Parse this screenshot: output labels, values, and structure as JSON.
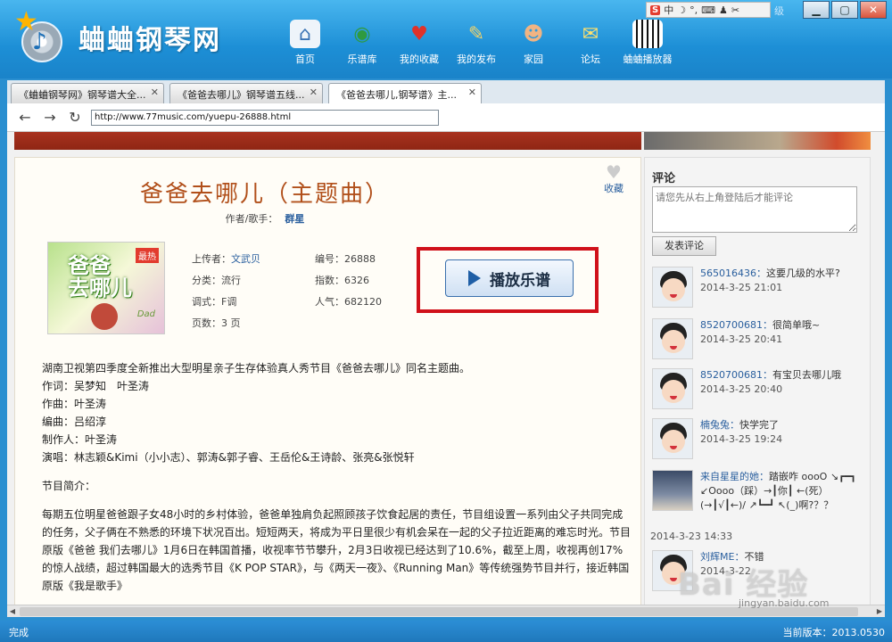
{
  "app": {
    "logo_text": "蛐蛐钢琴网",
    "nav": [
      {
        "label": "首页",
        "icon": "home-icon"
      },
      {
        "label": "乐谱库",
        "icon": "globe-icon"
      },
      {
        "label": "我的收藏",
        "icon": "heart-icon"
      },
      {
        "label": "我的发布",
        "icon": "pen-icon"
      },
      {
        "label": "家园",
        "icon": "people-icon"
      },
      {
        "label": "论坛",
        "icon": "chat-icon"
      },
      {
        "label": "蛐蛐播放器",
        "icon": "piano-icon"
      }
    ],
    "tray_label": "中",
    "tray_hint": "级"
  },
  "tabs": [
    {
      "label": "《蛐蛐钢琴网》钢琴谱大全..."
    },
    {
      "label": "《爸爸去哪儿》钢琴谱五线..."
    },
    {
      "label": "《爸爸去哪儿,钢琴谱》主..."
    }
  ],
  "toolbar": {
    "url": "http://www.77music.com/yuepu-26888.html"
  },
  "song": {
    "title": "爸爸去哪儿（主题曲）",
    "author_label": "作者/歌手：",
    "author": "群星",
    "fav_label": "收藏",
    "cover": {
      "title": "爸爸\n去哪儿",
      "badge": "最热",
      "sub": "Dad"
    },
    "meta_left": [
      {
        "label": "上传者：",
        "value": "文武贝"
      },
      {
        "label": "分类：",
        "value": "流行"
      },
      {
        "label": "调式：",
        "value": "F调"
      },
      {
        "label": "页数：",
        "value": "3 页"
      }
    ],
    "meta_right": [
      {
        "label": "编号：",
        "value": "26888"
      },
      {
        "label": "指数：",
        "value": "6326"
      },
      {
        "label": "人气：",
        "value": "682120"
      }
    ],
    "play_label": "播放乐谱",
    "desc_lines": [
      "湖南卫视第四季度全新推出大型明星亲子生存体验真人秀节目《爸爸去哪儿》同名主题曲。",
      "作词：吴梦知　叶圣涛",
      "作曲：叶圣涛",
      "编曲：吕绍淳",
      "制作人：叶圣涛",
      "演唱：林志颖&Kimi（小小志）、郭涛&郭子睿、王岳伦&王诗龄、张亮&张悦轩"
    ],
    "intro_heading": "节目简介：",
    "intro_para": "每期五位明星爸爸跟子女48小时的乡村体验，爸爸单独肩负起照顾孩子饮食起居的责任，节目组设置一系列由父子共同完成的任务，父子俩在不熟悉的环境下状况百出。短短两天，将成为平日里很少有机会呆在一起的父子拉近距离的难忘时光。节目原版《爸爸 我们去哪儿》1月6日在韩国首播，收视率节节攀升，2月3日收视已经达到了10.6%，截至上周，收视再创17%的惊人战绩，超过韩国最大的选秀节目《K POP STAR》，与《两天一夜》、《Running Man》等传统强势节目并行，接近韩国原版《我是歌手》"
  },
  "comments": {
    "title": "评论",
    "placeholder": "请您先从右上角登陆后才能评论",
    "submit": "发表评论",
    "items": [
      {
        "user": "565016436：",
        "text": "这要几级的水平?",
        "time": "2014-3-25 21:01"
      },
      {
        "user": "8520700681：",
        "text": "很简单哦~",
        "time": "2014-3-25 20:41"
      },
      {
        "user": "8520700681：",
        "text": "有宝贝去哪儿哦",
        "time": "2014-3-25 20:40"
      },
      {
        "user": "楠兔兔：",
        "text": "快学完了",
        "time": "2014-3-25 19:24"
      },
      {
        "user": "来自星星的她：",
        "text": "踏嵌咋 oooO ↘┏━┓ ↙Oooo（踩）→┃你┃ ←(死）(→┃√┃←)/ ↗┗━┛ ↖(_)啊?？？",
        "time": "2014-3-23 14:33"
      },
      {
        "user": "刘辉ME：",
        "text": "不错",
        "time": "2014-3-22"
      }
    ]
  },
  "status": {
    "left": "完成",
    "right": "当前版本：2013.0530"
  },
  "watermark": {
    "text": "Bai 经验",
    "sub": "jingyan.baidu.com"
  }
}
